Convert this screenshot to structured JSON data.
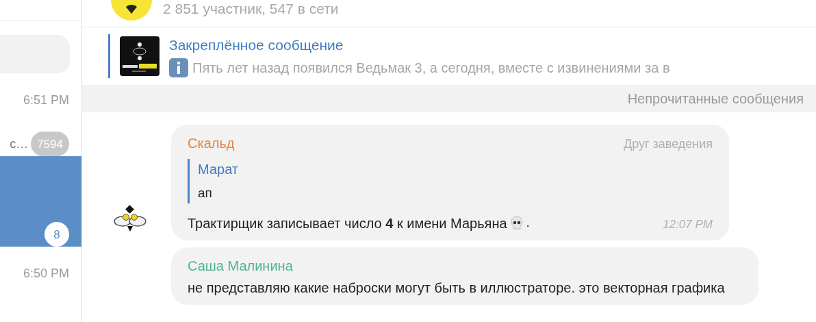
{
  "header": {
    "subtitle": "2 851 участник, 547 в сети"
  },
  "pinned": {
    "title": "Закреплённое сообщение",
    "text": "Пять лет назад появился Ведьмак 3, а сегодня, вместе с извинениями за в"
  },
  "unread_divider": "Непрочитанные сообщения",
  "sidebar": {
    "items": [
      {
        "time": "6:51 PM",
        "snippet": "с…",
        "badge": "7594",
        "selected": false
      },
      {
        "badge": "8",
        "selected": true
      },
      {
        "time": "6:50 PM",
        "selected": false
      }
    ]
  },
  "messages": [
    {
      "sender": "Скальд",
      "color": "#e8833a",
      "title": "Друг заведения",
      "avatar": true,
      "reply": {
        "sender": "Марат",
        "text": "ап"
      },
      "text": "Трактирщик записывает число **4** к имени Марьяна",
      "after_emoji": ".",
      "time": "12:07 PM"
    },
    {
      "sender": "Саша Малинина",
      "color": "#4fb395",
      "avatar": false,
      "text": "не представляю какие наброски могут быть в иллюстраторе. это векторная графика"
    }
  ]
}
